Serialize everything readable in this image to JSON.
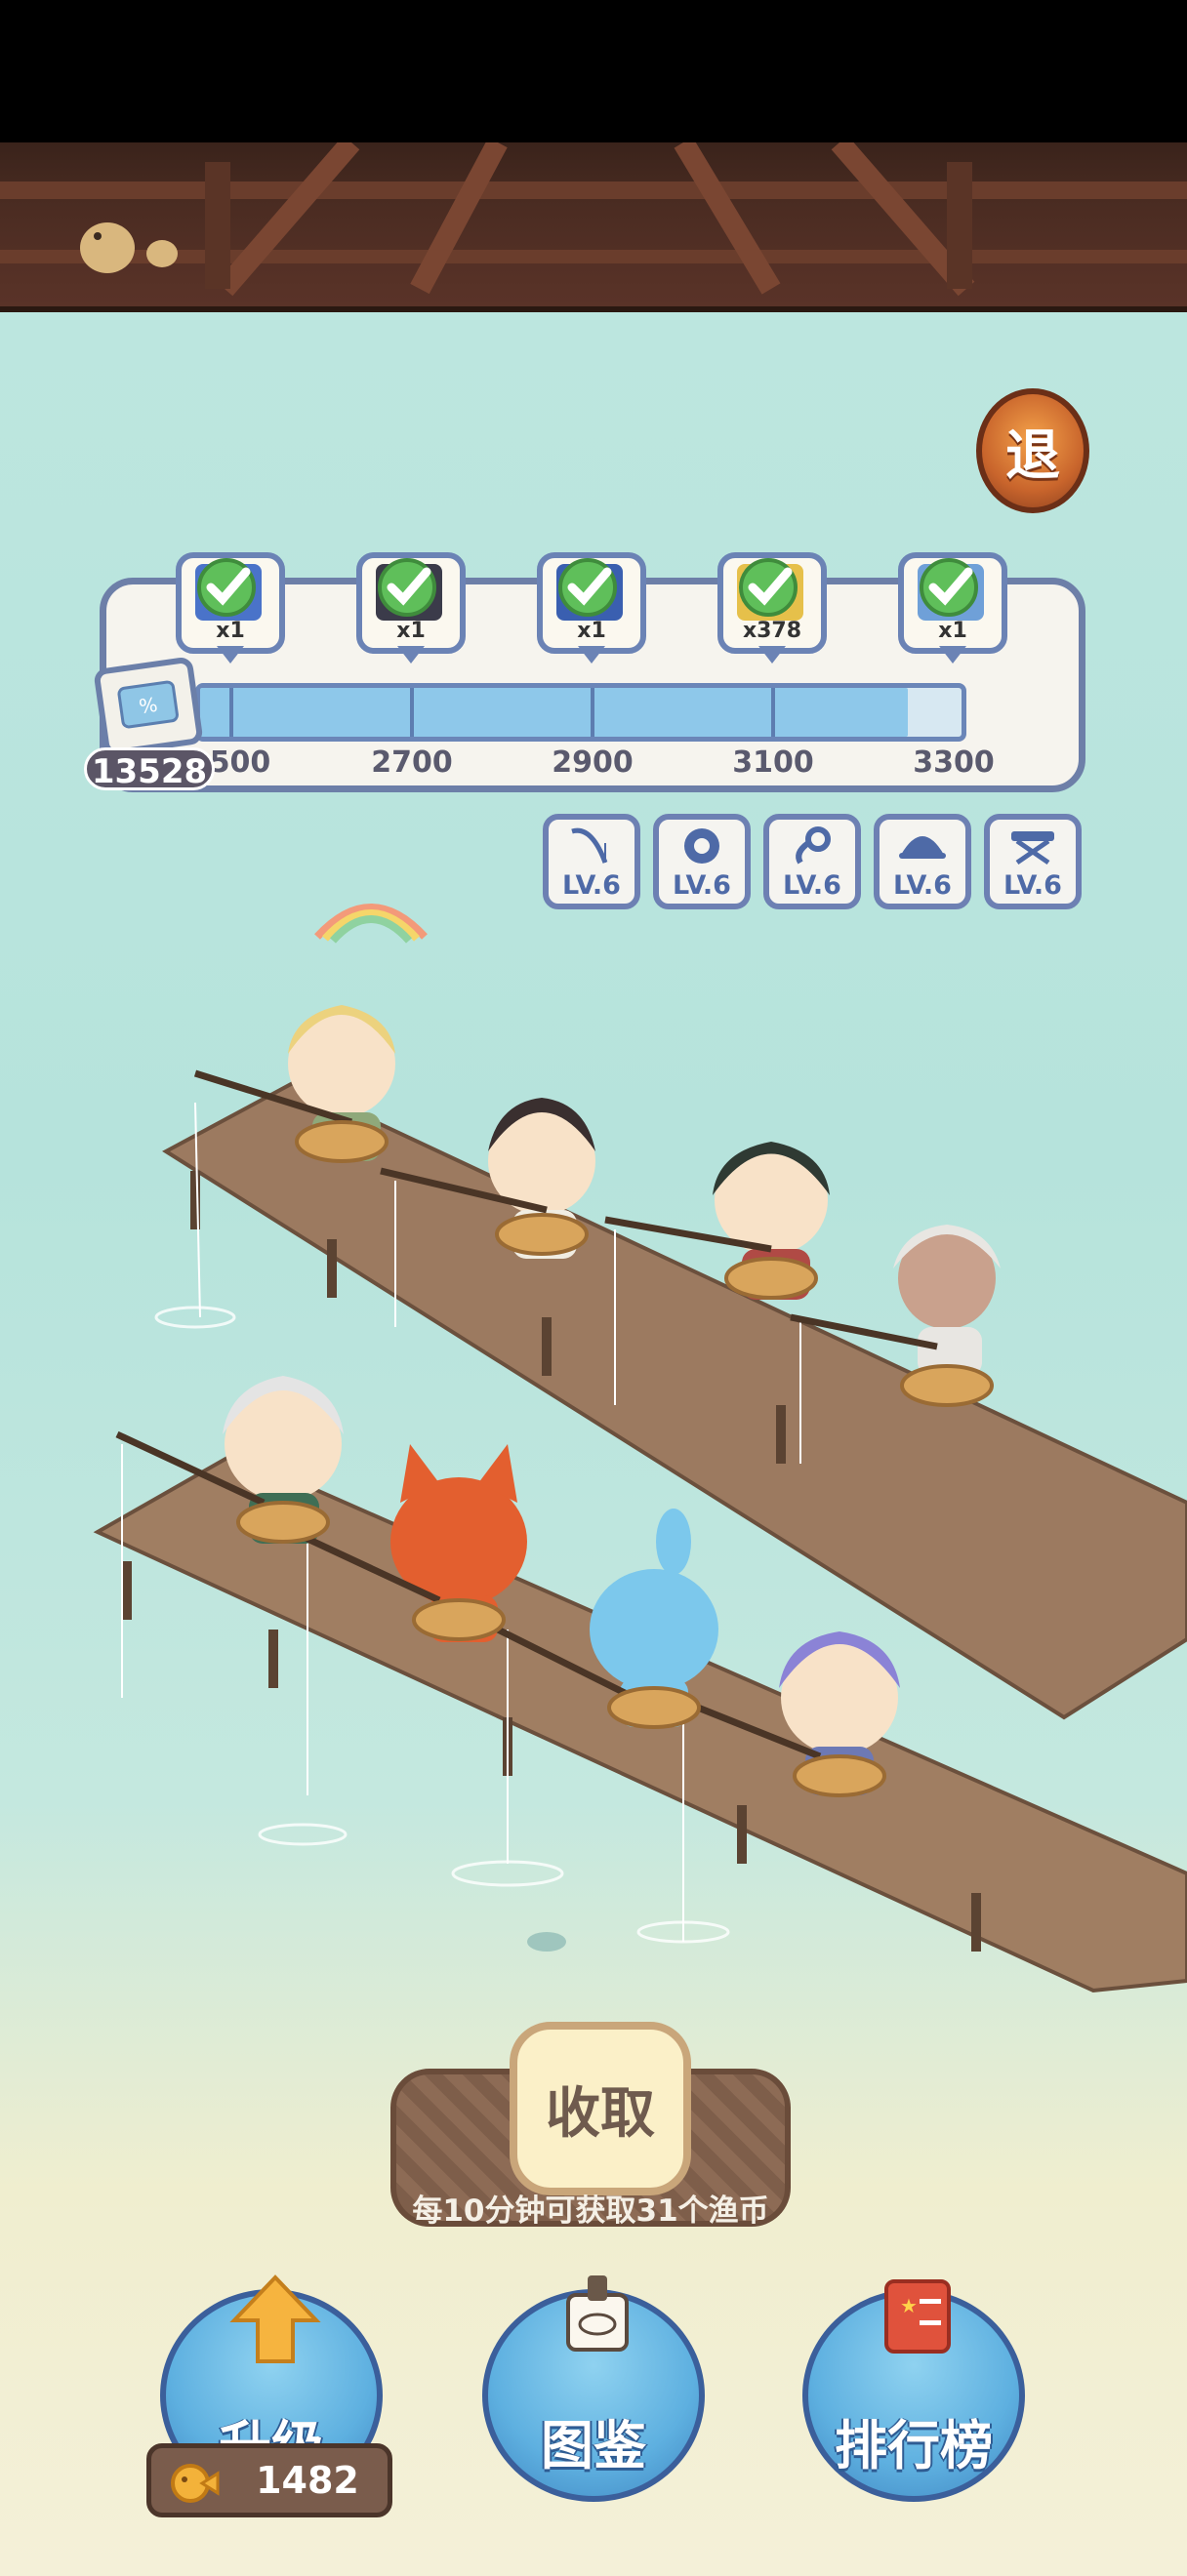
{
  "exit_button": {
    "label": "退"
  },
  "coupons": {
    "count": "13528"
  },
  "progress": {
    "fill": 0.93,
    "milestones": [
      {
        "label": "2500",
        "count": "x1"
      },
      {
        "label": "2700",
        "count": "x1"
      },
      {
        "label": "2900",
        "count": "x1"
      },
      {
        "label": "3100",
        "count": "x378"
      },
      {
        "label": "3300",
        "count": "x1"
      }
    ],
    "first_label_visible": "500"
  },
  "equipment": [
    {
      "name": "rod-icon",
      "level": "LV.6"
    },
    {
      "name": "reel-icon",
      "level": "LV.6"
    },
    {
      "name": "hook-icon",
      "level": "LV.6"
    },
    {
      "name": "hat-icon",
      "level": "LV.6"
    },
    {
      "name": "stool-icon",
      "level": "LV.6"
    }
  ],
  "collect": {
    "label": "收取",
    "hint": "每10分钟可获取31个渔币"
  },
  "nav": {
    "upgrade": "升级",
    "catalog": "图鉴",
    "ranking": "排行榜"
  },
  "currency": {
    "fish_coins": "1482"
  },
  "colors": {
    "water": "#b6e3dc",
    "dock": "#9c7a60",
    "accent": "#5eb0e0"
  }
}
